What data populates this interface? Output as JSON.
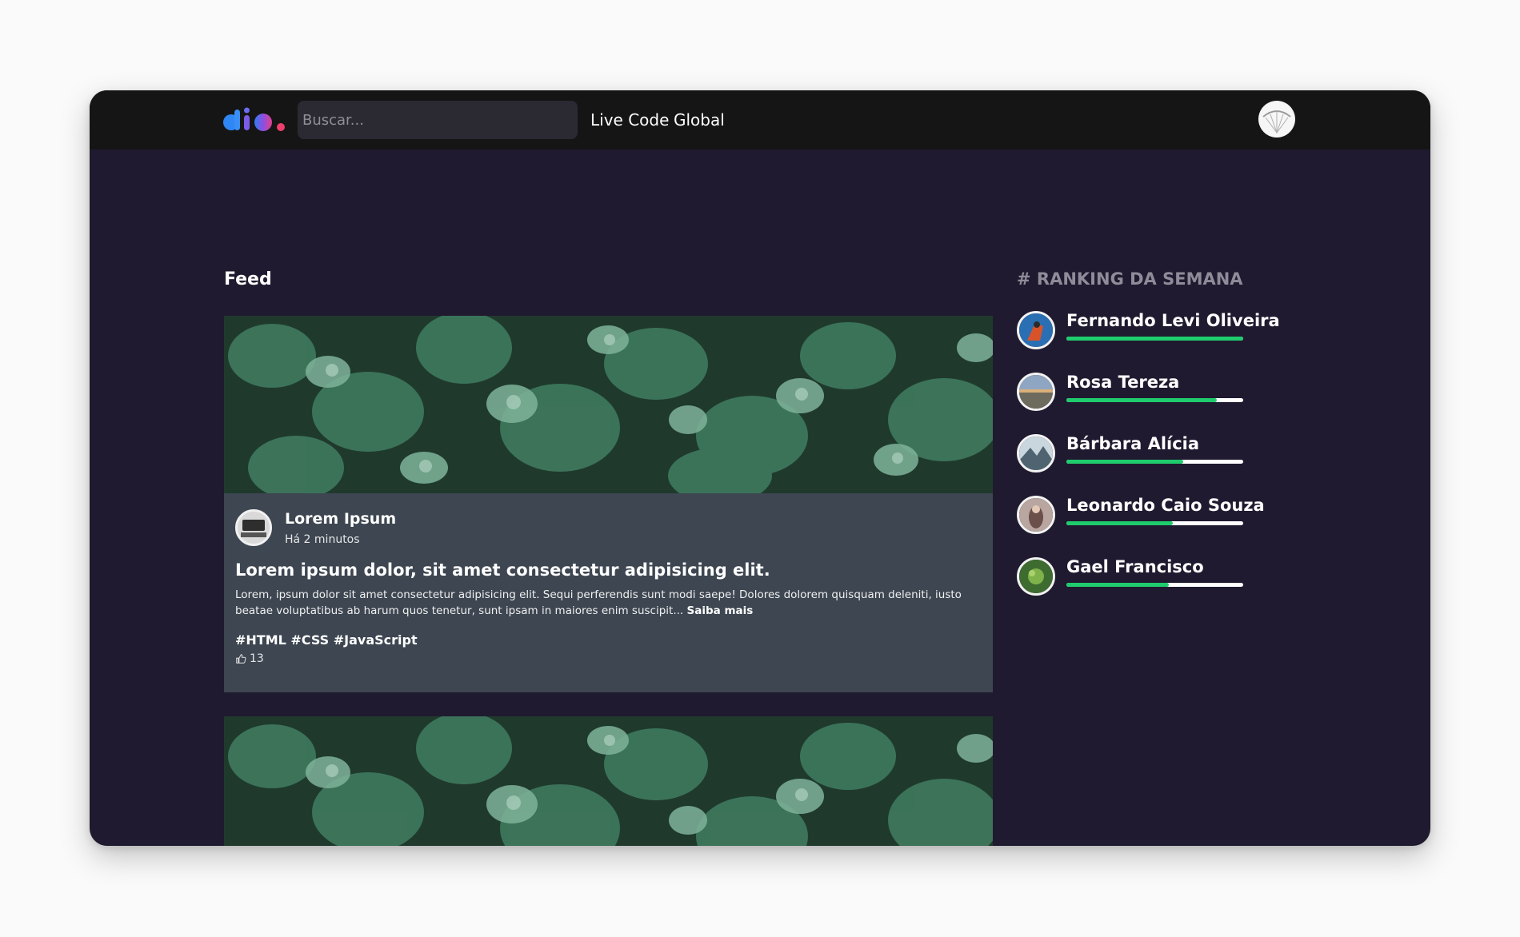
{
  "header": {
    "search_placeholder": "Buscar...",
    "nav": [
      {
        "label": "Live Code"
      },
      {
        "label": "Global"
      }
    ]
  },
  "feed": {
    "title": "Feed",
    "posts": [
      {
        "author": "Lorem Ipsum",
        "time": "Há 2 minutos",
        "title": "Lorem ipsum dolor, sit amet consectetur adipisicing elit.",
        "text": "Lorem, ipsum dolor sit amet consectetur adipisicing elit. Sequi perferendis sunt modi saepe! Dolores dolorem quisquam deleniti, iusto beatae voluptatibus ab harum quos tenetur, sunt ipsam in maiores enim suscipit...",
        "read_more": "Saiba mais",
        "tags": "#HTML #CSS #JavaScript",
        "likes": "13"
      }
    ]
  },
  "ranking": {
    "title": "# RANKING DA SEMANA",
    "users": [
      {
        "name": "Fernando Levi Oliveira",
        "progress": 1.0
      },
      {
        "name": "Rosa Tereza",
        "progress": 0.85
      },
      {
        "name": "Bárbara Alícia",
        "progress": 0.66
      },
      {
        "name": "Leonardo Caio Souza",
        "progress": 0.6
      },
      {
        "name": "Gael Francisco",
        "progress": 0.58
      }
    ]
  },
  "colors": {
    "background": "#1f1a2f",
    "header": "#151515",
    "card": "#3d4651",
    "progress": "#1fcc6d",
    "ranking_title": "#8f8c9a"
  }
}
